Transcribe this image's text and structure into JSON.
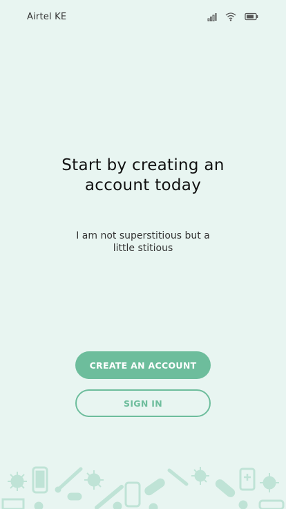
{
  "status_bar": {
    "carrier": "Airtel KE",
    "icons": [
      "signal-icon",
      "wifi-icon",
      "battery-icon"
    ]
  },
  "onboarding": {
    "headline_line1": "Start by creating an",
    "headline_line2": "account today",
    "subtitle_line1": "I am not superstitious but a",
    "subtitle_line2": "little stitious"
  },
  "actions": {
    "create_account_label": "CREATE AN ACCOUNT",
    "sign_in_label": "SIGN IN"
  },
  "colors": {
    "background": "#e8f5f1",
    "accent": "#6dbd9c",
    "pattern": "#bfe3d6"
  },
  "decoration": {
    "icons": [
      "virus-icon",
      "phone-icon",
      "thermometer-icon",
      "pill-icon",
      "syringe-icon",
      "first-aid-icon"
    ]
  }
}
